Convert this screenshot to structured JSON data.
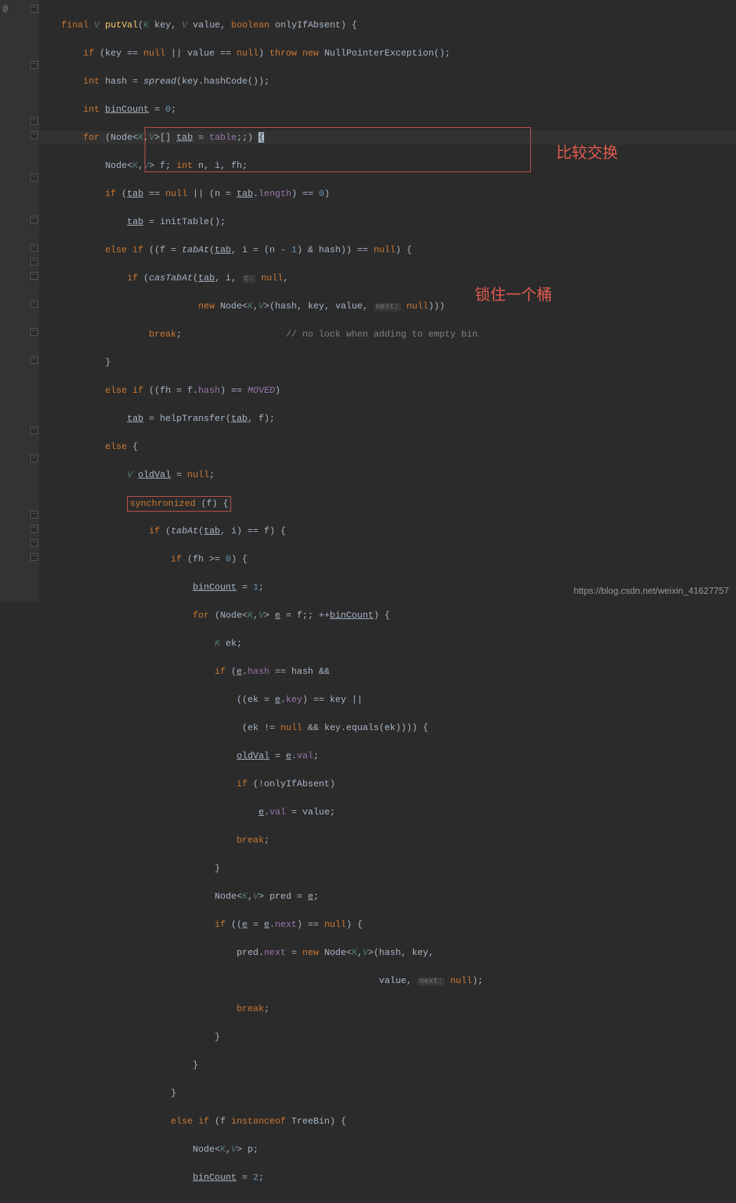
{
  "gutter": {
    "at": "@"
  },
  "annotations": {
    "cas": "比较交换",
    "lock": "锁住一个桶"
  },
  "watermark": "https://blog.csdn.net/weixin_41627757",
  "code": {
    "l0": "    final V putVal(K key, V value, boolean onlyIfAbsent) {",
    "l1": "        if (key == null || value == null) throw new NullPointerException();",
    "l2": "        int hash = spread(key.hashCode());",
    "l3": "        int binCount = 0;",
    "l4": "        for (Node<K,V>[] tab = table;;) {",
    "l5": "            Node<K,V> f; int n, i, fh;",
    "l6": "            if (tab == null || (n = tab.length) == 0)",
    "l7": "                tab = initTable();",
    "l8": "            else if ((f = tabAt(tab, i = (n - 1) & hash)) == null) {",
    "l9": "                if (casTabAt(tab, i, c: null,",
    "l10": "                             new Node<K,V>(hash, key, value, next: null)))",
    "l11": "                    break;                   // no lock when adding to empty bin",
    "l12": "            }",
    "l13": "            else if ((fh = f.hash) == MOVED)",
    "l14": "                tab = helpTransfer(tab, f);",
    "l15": "            else {",
    "l16": "                V oldVal = null;",
    "l17": "                synchronized (f) {",
    "l18": "                    if (tabAt(tab, i) == f) {",
    "l19": "                        if (fh >= 0) {",
    "l20": "                            binCount = 1;",
    "l21": "                            for (Node<K,V> e = f;; ++binCount) {",
    "l22": "                                K ek;",
    "l23": "                                if (e.hash == hash &&",
    "l24": "                                    ((ek = e.key) == key ||",
    "l25": "                                     (ek != null && key.equals(ek)))) {",
    "l26": "                                    oldVal = e.val;",
    "l27": "                                    if (!onlyIfAbsent)",
    "l28": "                                        e.val = value;",
    "l29": "                                    break;",
    "l30": "                                }",
    "l31": "                                Node<K,V> pred = e;",
    "l32": "                                if ((e = e.next) == null) {",
    "l33": "                                    pred.next = new Node<K,V>(hash, key,",
    "l34": "                                                              value, next: null);",
    "l35": "                                    break;",
    "l36": "                                }",
    "l37": "                            }",
    "l38": "                        }",
    "l39": "                        else if (f instanceof TreeBin) {",
    "l40": "                            Node<K,V> p;",
    "l41": "                            binCount = 2;"
  }
}
